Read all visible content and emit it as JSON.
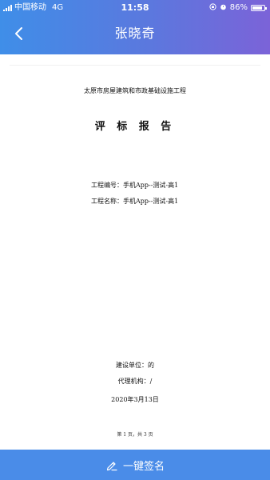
{
  "status_bar": {
    "carrier": "中国移动",
    "network": "4G",
    "time": "11:58",
    "battery_percent": "86%",
    "battery_level": 0.86
  },
  "navbar": {
    "title": "张晓奇",
    "back_icon": "chevron-left-icon"
  },
  "document": {
    "subtitle": "太原市房屋建筑和市政基础设施工程",
    "title": "评 标 报 告",
    "project_number_label": "工程编号：",
    "project_number_value": "手机App--测试-高1",
    "project_name_label": "工程名称：",
    "project_name_value": "手机App--测试-高1",
    "builder_label": "建设单位：",
    "builder_value": "的",
    "agency_label": "代理机构：",
    "agency_value": "/",
    "date": "2020年3月13日",
    "page_indicator": "第 1 页，共 3 页"
  },
  "sign_button": {
    "label": "一键签名",
    "icon": "pen-icon"
  },
  "colors": {
    "header_gradient_start": "#3f8ee8",
    "header_gradient_end": "#7b63d8",
    "sign_bar": "#4a8ce8"
  }
}
